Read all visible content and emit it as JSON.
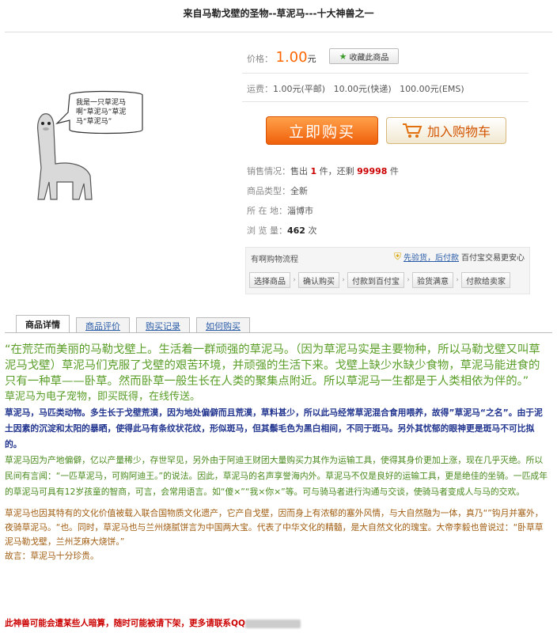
{
  "page_title": "来自马勒戈壁的圣物--草泥马---十大神兽之一",
  "illustration": {
    "speech": "我是一只草泥马\n啊“草泥马”草泥\n马“草泥马”"
  },
  "price": {
    "label": "价格：",
    "value": "1.00",
    "unit": "元",
    "favorite_button": "收藏此商品"
  },
  "shipping": {
    "label": "运费：",
    "text": "1.00元(平邮)   10.00元(快递)   100.00元(EMS)"
  },
  "buttons": {
    "buy_now": "立即购买",
    "add_to_cart": "加入购物车"
  },
  "info": {
    "sales_label": "销售情况：",
    "sales_prefix": "售出 ",
    "sales_count": "1",
    "sales_mid": " 件，还剩 ",
    "remaining": "99998",
    "sales_suffix": " 件",
    "type_label": "商品类型：",
    "type_value": "全新",
    "location_label": "所 在 地：",
    "location_value": "淄博市",
    "views_label": "浏 览 量：",
    "views_value": "462",
    "views_unit": " 次"
  },
  "flow": {
    "title": "有啊购物流程",
    "guarantee_link": "先验货，后付款",
    "guarantee_note": "百付宝交易更安心",
    "steps": [
      "选择商品",
      "确认购买",
      "付款到百付宝",
      "验货满意",
      "付款给卖家"
    ]
  },
  "tabs": [
    "商品详情",
    "商品评价",
    "购买记录",
    "如何购买"
  ],
  "description": {
    "para1": "“在荒茫而美丽的马勒戈壁上。生活着一群顽强的草泥马。（因为草泥马实是主要物种，所以马勒戈壁又叫草泥马戈壁）草泥马们克服了戈壁的艰苦环境，并顽强的生活下来。戈壁上缺少水缺少食物，草泥马能进食的只有一种草——卧草。然而卧草一般生长在人类的聚集点附近。所以草泥马一生都是于人类相依为伴的。”",
    "para1b": "草泥马为电子宠物，即买既得，在线传送。",
    "para2": "  草泥马，马匹类动物。多生长于戈壁荒漠，因为地处偏僻而且荒漠，草料甚少，所以此马经常草泥混合食用喂养，故得”草泥马“之名”。由于泥土因素的沉淀和太阳的暴晒，使得此马有条纹状花纹，形似斑马，但其鬃毛色为黑白相间，不同于斑马。另外其忧郁的眼神更是斑马不可比拟的。",
    "para3": "草泥马因为产地偏僻，亿以产量稀少，存世罕见，另外由于阿迪王财团大量购买力其作为运输工具，使得其身价更加上涨，现在几乎灭绝。所以民间有言闻：“一匹草泥马，可购阿迪王。”的说法。因此，草泥马的名声享誉海内外。草泥马不仅是良好的运输工具，更是绝佳的坐骑。一匹成年的草泥马可具有12岁孩童的智商，可言，会常用语言。如“傻×”“我×你×”等。可与骑马者进行沟通与交谈，使骑马者变成人与马的交欢。",
    "para4": "  草泥马也因其特有的文化价值被载入联合国物质文化遗产，它产自戈壁，因而身上有浓郁的塞外风情，与大自然融为一体，真乃“”钩月并塞外，夜骑草泥马。“也。同时，草泥马也与兰州烧腻饼言为中国两大宝。代表了中华文化的精髓，是大自然文化的瑰宝。大帝李毅也曾说过：“卧草草泥马勒戈壁，兰州芝麻大烧饼。”",
    "para4b": "故言：草泥马十分珍贵。",
    "footer": "此神兽可能会遭某些人暗算，随时可能被请下架，更多请联系QQ"
  }
}
